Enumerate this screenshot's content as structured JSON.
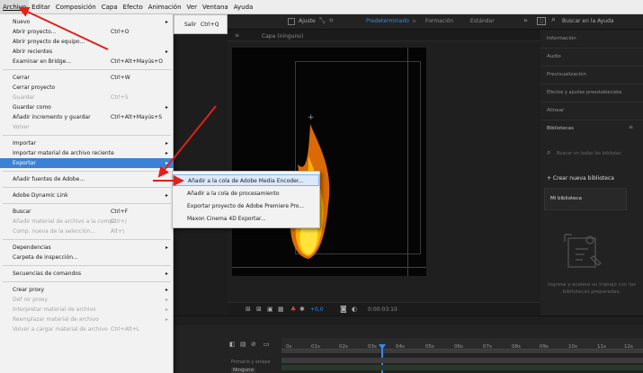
{
  "menubar": {
    "items": [
      "Archivo",
      "Editar",
      "Composición",
      "Capa",
      "Efecto",
      "Animación",
      "Ver",
      "Ventana",
      "Ayuda"
    ]
  },
  "toolbar": {
    "ajuste": "Ajuste",
    "workspaces": [
      "Predeterminado",
      "Formación",
      "Estándar"
    ],
    "search_placeholder": "Buscar en la Ayuda"
  },
  "comp_panel": {
    "tab": "Capa (ninguno)",
    "zoom_value": "+0,0",
    "timecode": "0:00:03:10"
  },
  "file_menu": {
    "items": [
      {
        "label": "Nuevo",
        "shortcut": "",
        "arrow": true,
        "disabled": false
      },
      {
        "label": "Abrir proyecto...",
        "shortcut": "Ctrl+O",
        "arrow": false,
        "disabled": false
      },
      {
        "label": "Abrir proyecto de equipo...",
        "shortcut": "",
        "arrow": false,
        "disabled": false
      },
      {
        "label": "Abrir recientes",
        "shortcut": "",
        "arrow": true,
        "disabled": false
      },
      {
        "label": "Examinar en Bridge...",
        "shortcut": "Ctrl+Alt+Mayús+O",
        "arrow": false,
        "disabled": false
      },
      {
        "label": "Cerrar",
        "shortcut": "Ctrl+W",
        "arrow": false,
        "disabled": false
      },
      {
        "label": "Cerrar proyecto",
        "shortcut": "",
        "arrow": false,
        "disabled": false
      },
      {
        "label": "Guardar",
        "shortcut": "Ctrl+S",
        "arrow": false,
        "disabled": true
      },
      {
        "label": "Guardar como",
        "shortcut": "",
        "arrow": true,
        "disabled": false
      },
      {
        "label": "Añadir incremento y guardar",
        "shortcut": "Ctrl+Alt+Mayús+S",
        "arrow": false,
        "disabled": false
      },
      {
        "label": "Volver",
        "shortcut": "",
        "arrow": false,
        "disabled": true
      },
      {
        "label": "Importar",
        "shortcut": "",
        "arrow": true,
        "disabled": false
      },
      {
        "label": "Importar material de archivo reciente",
        "shortcut": "",
        "arrow": true,
        "disabled": false
      },
      {
        "label": "Exportar",
        "shortcut": "",
        "arrow": true,
        "disabled": false,
        "highlighted": true
      },
      {
        "label": "Añadir fuentes de Adobe...",
        "shortcut": "",
        "arrow": false,
        "disabled": false
      },
      {
        "label": "Adobe Dynamic Link",
        "shortcut": "",
        "arrow": true,
        "disabled": false
      },
      {
        "label": "Buscar",
        "shortcut": "Ctrl+F",
        "arrow": false,
        "disabled": false
      },
      {
        "label": "Añadir material de archivo a la compo",
        "shortcut": "Ctrl+/",
        "arrow": false,
        "disabled": true
      },
      {
        "label": "Comp. nueva de la selección...",
        "shortcut": "Alt+\\",
        "arrow": false,
        "disabled": true
      },
      {
        "label": "Dependencias",
        "shortcut": "",
        "arrow": true,
        "disabled": false
      },
      {
        "label": "Carpeta de inspección...",
        "shortcut": "",
        "arrow": false,
        "disabled": false
      },
      {
        "label": "Secuencias de comandos",
        "shortcut": "",
        "arrow": true,
        "disabled": false
      },
      {
        "label": "Crear proxy",
        "shortcut": "",
        "arrow": true,
        "disabled": false
      },
      {
        "label": "Def nir proxy",
        "shortcut": "",
        "arrow": true,
        "disabled": true
      },
      {
        "label": "Interpretar material de archivo",
        "shortcut": "",
        "arrow": true,
        "disabled": true
      },
      {
        "label": "Reemplazar material de archivo",
        "shortcut": "",
        "arrow": true,
        "disabled": true
      },
      {
        "label": "Volver a cargar material de archivo",
        "shortcut": "Ctrl+Alt+L",
        "arrow": false,
        "disabled": true
      }
    ]
  },
  "nuevo_submenu": {
    "label": "Salir",
    "shortcut": "Ctrl+Q"
  },
  "export_submenu": {
    "items": [
      "Añadir a la cola de Adobe Media Encoder...",
      "Añadir a la cola de procesamiento",
      "Exportar proyecto de Adobe Premiere Pro...",
      "Maxon Cinema 4D Exportar..."
    ]
  },
  "right_panel": {
    "items": [
      "Información",
      "Audio",
      "Previsualización",
      "Efectos y ajustes preestablecidos",
      "Alinear",
      "Bibliotecas"
    ],
    "search_placeholder": "Buscar en todas las bibliotec",
    "create_library": "+ Crear nueva biblioteca",
    "my_library": "Mi biblioteca",
    "empty_message": "Ingrese y acelere su trabajo con las bibliotecas preparadas."
  },
  "timeline": {
    "ruler": [
      "0s",
      "01s",
      "02s",
      "03s",
      "04s",
      "05s",
      "06s",
      "07s",
      "08s",
      "09s",
      "10s",
      "11s",
      "12s"
    ],
    "layer_label": "Ninguno"
  },
  "colors": {
    "highlight": "#3b82d6",
    "arrow": "#e0201b",
    "accent_blue": "#2d8ceb"
  }
}
